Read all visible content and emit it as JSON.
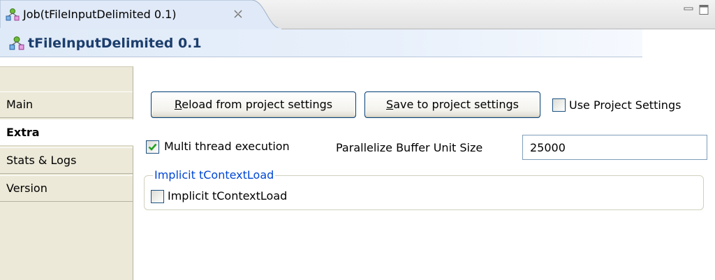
{
  "editor_tab": {
    "title": "Job(tFileInputDelimited 0.1)",
    "icon": "job-icon",
    "close_icon": "close-icon"
  },
  "header": {
    "title": "tFileInputDelimited 0.1",
    "icon": "job-icon"
  },
  "sidebar": {
    "items": [
      {
        "label": "Main",
        "active": false
      },
      {
        "label": "Extra",
        "active": true
      },
      {
        "label": "Stats & Logs",
        "active": false
      },
      {
        "label": "Version",
        "active": false
      }
    ]
  },
  "toolbar": {
    "reload_mnemonic": "R",
    "reload_rest": "eload from project settings",
    "save_mnemonic": "S",
    "save_rest": "ave to project settings",
    "use_project_settings_label": "Use Project Settings",
    "use_project_settings_checked": false
  },
  "extra": {
    "multi_thread_label": "Multi thread execution",
    "multi_thread_checked": true,
    "buffer_label": "Parallelize Buffer Unit Size",
    "buffer_value": "25000"
  },
  "implicit_group": {
    "legend": "Implicit tContextLoad",
    "checkbox_label": "Implicit tContextLoad",
    "checked": false
  },
  "colors": {
    "legend": "#0046d5",
    "header_title": "#1c3e6d",
    "check_mark": "#21a121"
  }
}
